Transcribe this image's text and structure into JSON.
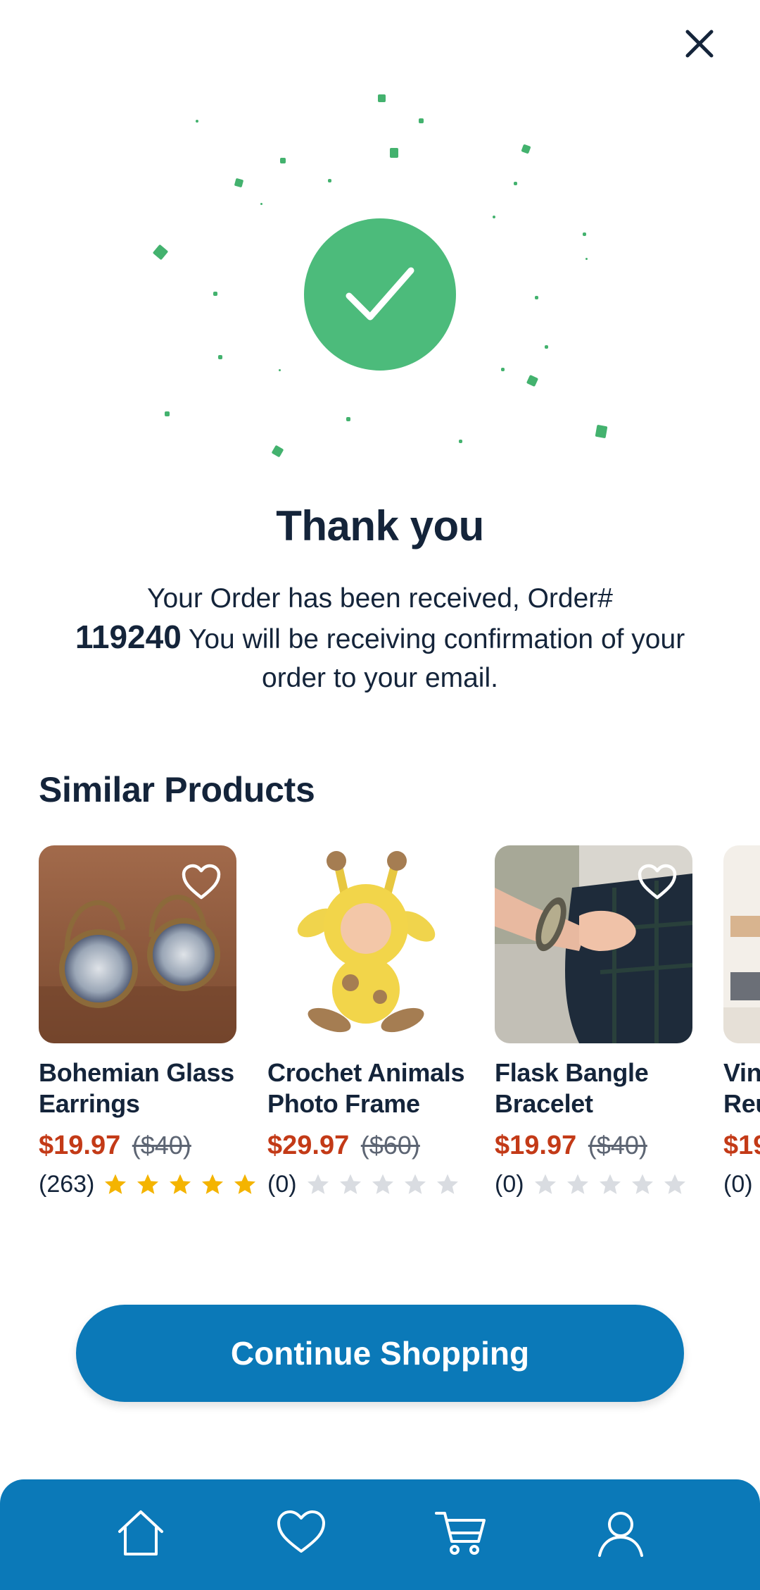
{
  "header": {
    "close_icon": "close-icon"
  },
  "confirmation": {
    "title": "Thank you",
    "message_before": "Your Order has been received, Order#",
    "order_number": "119240",
    "message_after": "You will be receiving confirmation of your order to your email.",
    "icon": "check-circle-icon",
    "accent_color": "#4cbb7b"
  },
  "similar": {
    "title": "Similar Products",
    "products": [
      {
        "name_line1": "Bohemian Glass",
        "name_line2": "Earrings",
        "price": "$19.97",
        "old_price": "($40)",
        "reviews": "(263)",
        "rating": 5,
        "favorite_icon": true
      },
      {
        "name_line1": "Crochet Animals",
        "name_line2": "Photo Frame",
        "price": "$29.97",
        "old_price": "($60)",
        "reviews": "(0)",
        "rating": 0,
        "favorite_icon": false
      },
      {
        "name_line1": "Flask Bangle",
        "name_line2": "Bracelet",
        "price": "$19.97",
        "old_price": "($40)",
        "reviews": "(0)",
        "rating": 0,
        "favorite_icon": true
      },
      {
        "name_line1": "Vin",
        "name_line2": "Reu",
        "price": "$19",
        "old_price": "",
        "reviews": "(0)",
        "rating": 0,
        "favorite_icon": false
      }
    ]
  },
  "cta": {
    "label": "Continue Shopping"
  },
  "nav": {
    "items": [
      {
        "icon": "home-icon"
      },
      {
        "icon": "heart-icon"
      },
      {
        "icon": "cart-icon"
      },
      {
        "icon": "user-icon"
      }
    ]
  },
  "colors": {
    "primary": "#0b79b8",
    "price": "#c33a17",
    "star_filled": "#f4b400",
    "star_empty": "#d9dce1",
    "text": "#14243a"
  }
}
